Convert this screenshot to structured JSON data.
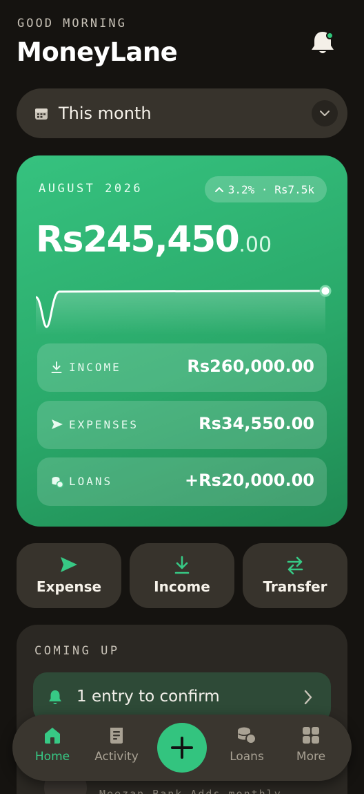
{
  "header": {
    "greeting": "GOOD MORNING",
    "app_title": "MoneyLane",
    "notification_dot": true
  },
  "period_selector": {
    "label": "This month"
  },
  "balance_card": {
    "month_label": "AUGUST 2026",
    "change_text": "3.2% · Rs7.5k",
    "amount_main": "Rs245,450",
    "amount_decimals": ".00",
    "rows": [
      {
        "label": "INCOME",
        "value": "Rs260,000.00",
        "icon": "download-icon"
      },
      {
        "label": "EXPENSES",
        "value": "Rs34,550.00",
        "icon": "send-icon"
      },
      {
        "label": "LOANS",
        "value": "+Rs20,000.00",
        "icon": "coins-icon"
      }
    ]
  },
  "quick_actions": [
    {
      "label": "Expense",
      "icon": "send-icon"
    },
    {
      "label": "Income",
      "icon": "download-icon"
    },
    {
      "label": "Transfer",
      "icon": "transfer-icon"
    }
  ],
  "coming_up": {
    "title": "COMING UP",
    "confirm_text": "1 entry to confirm",
    "peek_text": "Meezan Bank    Adds monthly"
  },
  "bottom_nav": [
    {
      "label": "Home",
      "icon": "home-icon",
      "active": true
    },
    {
      "label": "Activity",
      "icon": "receipt-icon",
      "active": false
    },
    {
      "label": "Loans",
      "icon": "coins-icon",
      "active": false
    },
    {
      "label": "More",
      "icon": "grid-icon",
      "active": false
    }
  ],
  "colors": {
    "accent": "#33c47f",
    "card_green": "#2aa96a",
    "background": "#151310",
    "surface": "#37332c"
  }
}
